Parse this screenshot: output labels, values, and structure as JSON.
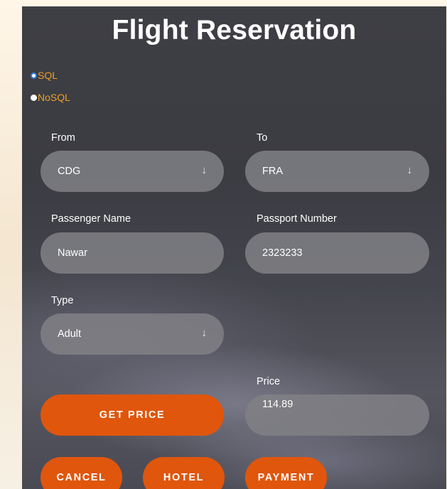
{
  "title": "Flight Reservation",
  "db_options": [
    {
      "label": "SQL",
      "checked": true
    },
    {
      "label": "NoSQL",
      "checked": false
    }
  ],
  "from": {
    "label": "From",
    "value": "CDG"
  },
  "to": {
    "label": "To",
    "value": "FRA"
  },
  "passenger_name": {
    "label": "Passenger Name",
    "value": "Nawar"
  },
  "passport_number": {
    "label": "Passport Number",
    "value": "2323233"
  },
  "type": {
    "label": "Type",
    "value": "Adult"
  },
  "price": {
    "label": "Price",
    "value": "114.89"
  },
  "buttons": {
    "get_price": "GET PRICE",
    "cancel": "CANCEL",
    "hotel": "HOTEL",
    "payment": "PAYMENT"
  },
  "icons": {
    "dropdown": "↓"
  },
  "colors": {
    "accent": "#e0560c",
    "radio_label": "#f0a020",
    "radio_checked": "#2f7be0"
  }
}
